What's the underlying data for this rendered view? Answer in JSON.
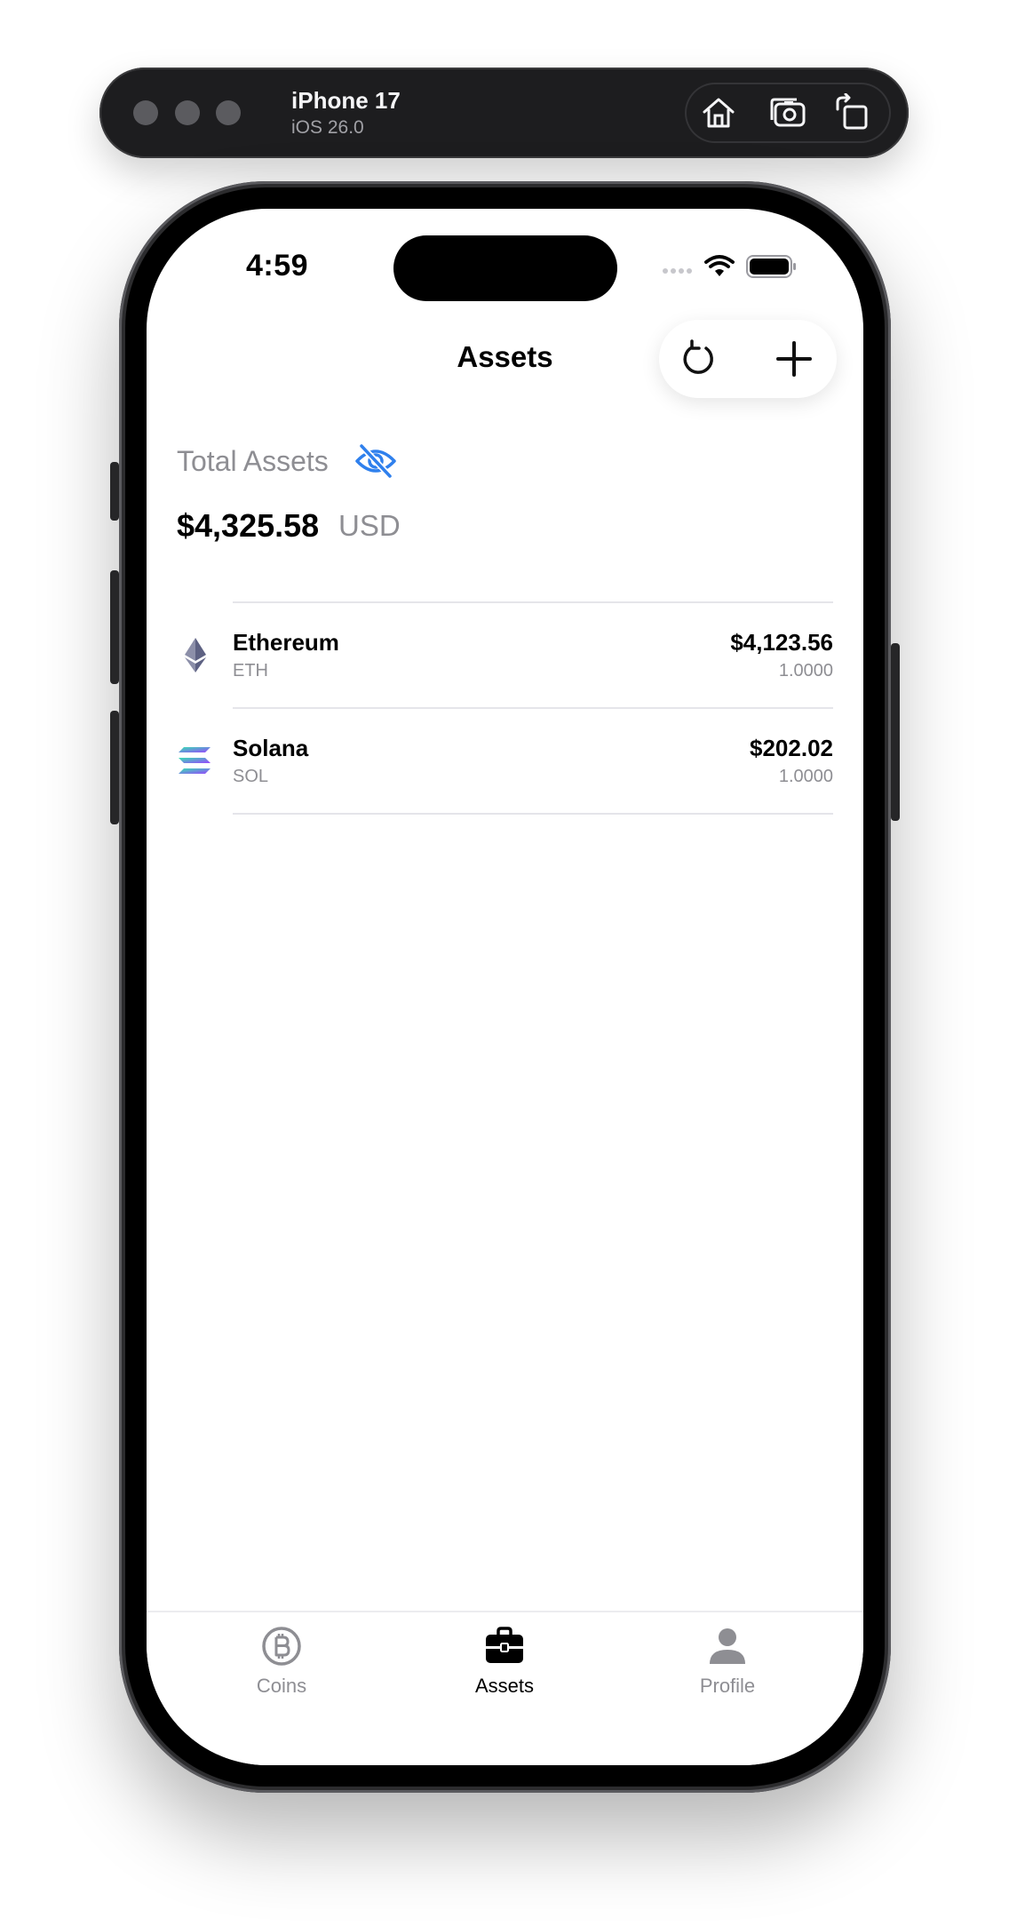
{
  "simulator": {
    "device_name": "iPhone 17",
    "os_version": "iOS 26.0",
    "controls": [
      "home-icon",
      "screenshot-icon",
      "rotate-icon"
    ]
  },
  "status_bar": {
    "time": "4:59",
    "icons": [
      "cellular-dots-icon",
      "wifi-icon",
      "battery-icon"
    ]
  },
  "nav": {
    "title": "Assets",
    "actions": [
      "refresh-icon",
      "plus-icon"
    ]
  },
  "summary": {
    "label": "Total Assets",
    "visibility_icon": "eye-slash-icon",
    "amount": "$4,325.58",
    "currency": "USD"
  },
  "assets": [
    {
      "name": "Ethereum",
      "symbol": "ETH",
      "value": "$4,123.56",
      "quantity": "1.0000",
      "icon": "ethereum-icon"
    },
    {
      "name": "Solana",
      "symbol": "SOL",
      "value": "$202.02",
      "quantity": "1.0000",
      "icon": "solana-icon"
    }
  ],
  "tabbar": {
    "items": [
      {
        "label": "Coins",
        "icon": "bitcoin-coin-icon",
        "selected": false
      },
      {
        "label": "Assets",
        "icon": "briefcase-icon",
        "selected": true
      },
      {
        "label": "Profile",
        "icon": "person-icon",
        "selected": false
      }
    ]
  },
  "colors": {
    "accent": "#2f80ed",
    "secondary_text": "#8e8e93",
    "primary_text": "#000000",
    "tab_inactive": "#8e8e93"
  }
}
